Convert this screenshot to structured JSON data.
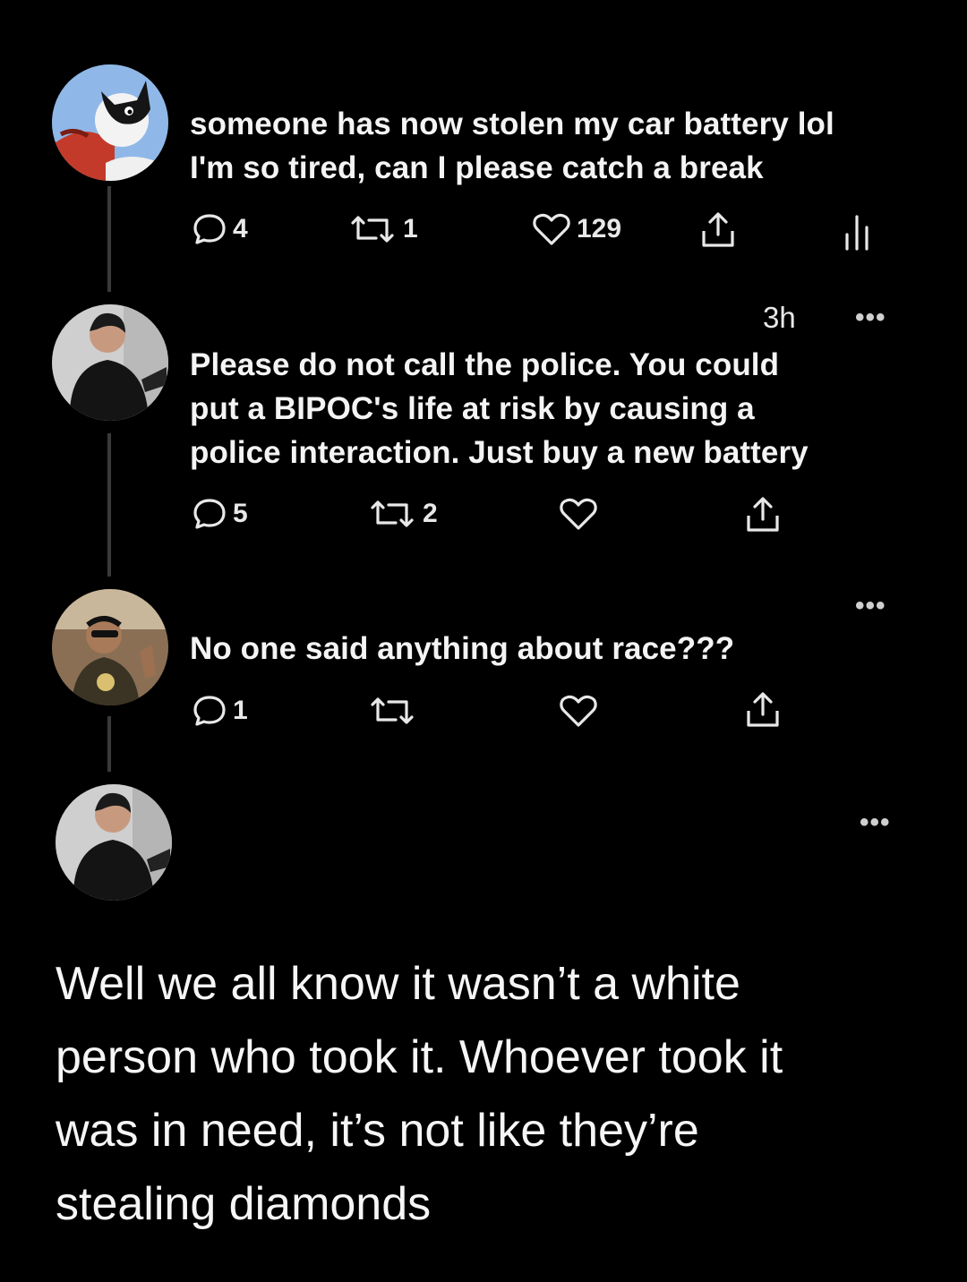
{
  "posts": [
    {
      "avatar": "cartoon-avatar",
      "lines": [
        "someone has now stolen my car battery lol",
        "I'm so tired, can I please catch a break"
      ],
      "replies": "4",
      "reposts": "1",
      "likes": "129"
    },
    {
      "avatar": "person-avatar",
      "timestamp": "3h",
      "more": "•••",
      "lines": [
        "Please do not call the police. You could",
        "put a BIPOC's life at risk by causing a",
        "police interaction. Just buy a new battery"
      ],
      "replies": "5",
      "reposts": "2"
    },
    {
      "avatar": "man-avatar",
      "more": "•••",
      "lines": [
        "No one said anything about race???"
      ],
      "replies": "1"
    },
    {
      "avatar": "person-avatar",
      "more": "•••"
    }
  ],
  "final_reply": {
    "lines": [
      "Well we all know it wasn’t a white",
      "person who took it. Whoever took it",
      "was in need, it’s not like they’re",
      "stealing diamonds"
    ]
  },
  "colors": {
    "background": "#000000",
    "text": "#f2f2f2",
    "thread_line": "#3a3a3a"
  }
}
